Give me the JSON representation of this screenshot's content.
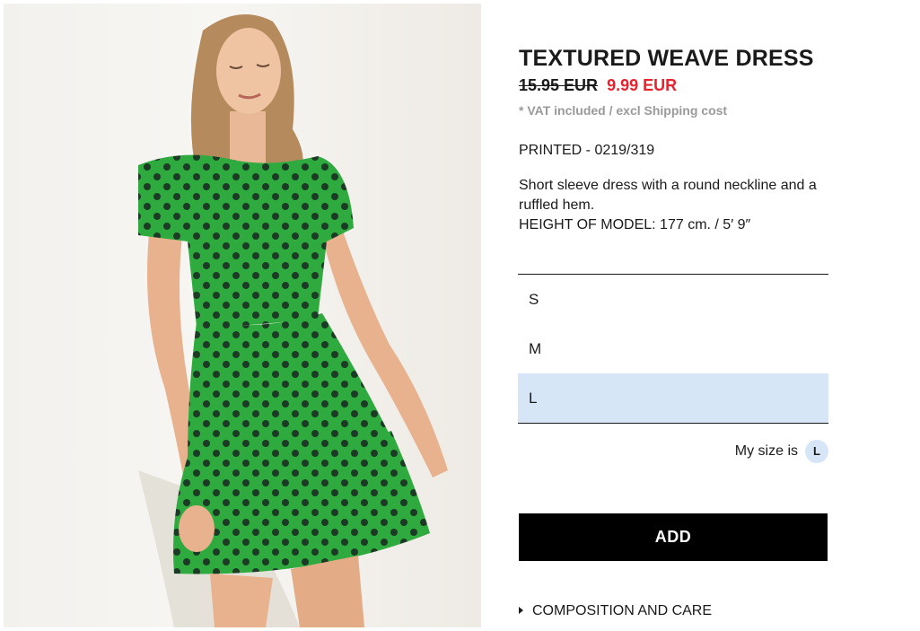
{
  "product": {
    "title": "TEXTURED WEAVE DRESS",
    "old_price": "15.95 EUR",
    "sale_price": "9.99 EUR",
    "vat_note": "* VAT included / excl Shipping cost",
    "reference": "PRINTED - 0219/319",
    "description_line1": "Short sleeve dress with a round neckline and a ruffled hem.",
    "description_line2": "HEIGHT OF MODEL: 177 cm. / 5′ 9″"
  },
  "sizes": {
    "options": [
      {
        "label": "S",
        "selected": false
      },
      {
        "label": "M",
        "selected": false
      },
      {
        "label": "L",
        "selected": true
      }
    ],
    "my_size_label": "My size is",
    "my_size_value": "L"
  },
  "actions": {
    "add_label": "ADD",
    "composition_label": "COMPOSITION AND CARE"
  },
  "colors": {
    "sale": "#e8232e",
    "selected_size_bg": "#d6e6f7",
    "button_bg": "#000000",
    "dress_green": "#2faa3f"
  },
  "icons": {
    "composition": "triangle-right-icon"
  }
}
